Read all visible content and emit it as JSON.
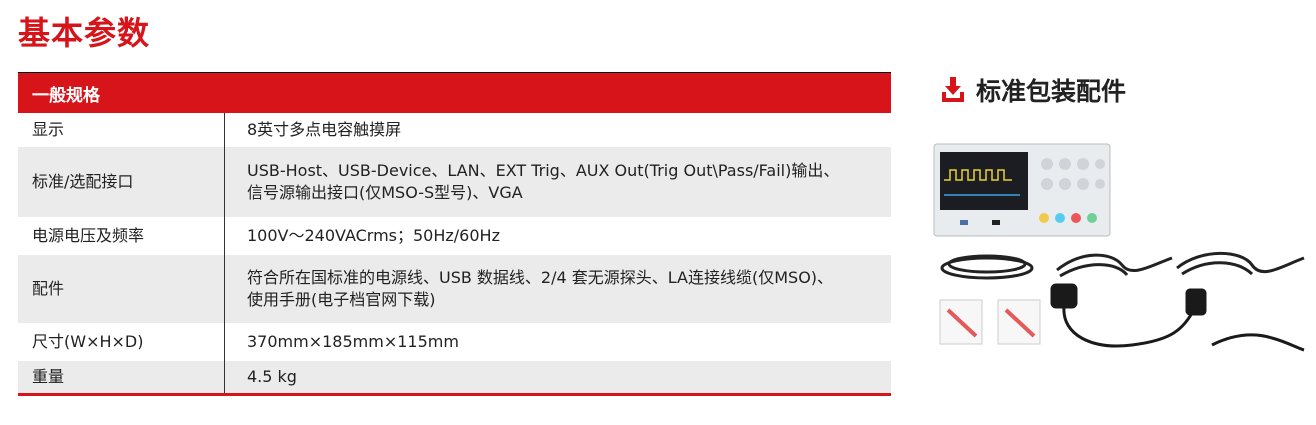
{
  "page_title": "基本参数",
  "spec_table": {
    "header": "一般规格",
    "rows": [
      {
        "label": "显示",
        "value": "8英寸多点电容触摸屏"
      },
      {
        "label": "标准/选配接口",
        "value": "USB-Host、USB-Device、LAN、EXT Trig、AUX Out(Trig Out\\Pass/Fail)输出、\n信号源输出接口(仅MSO-S型号)、VGA"
      },
      {
        "label": "电源电压及频率",
        "value": "100V～240VACrms；50Hz/60Hz"
      },
      {
        "label": "配件",
        "value": "符合所在国标准的电源线、USB 数据线、2/4 套无源探头、LA连接线缆(仅MSO)、\n使用手册(电子档官网下载)"
      },
      {
        "label": "尺寸(W×H×D)",
        "value": "370mm×185mm×115mm"
      },
      {
        "label": "重量",
        "value": "4.5 kg"
      }
    ]
  },
  "accessories": {
    "title": "标准包装配件",
    "icon": "download-icon"
  },
  "colors": {
    "accent": "#d7141a",
    "stripe": "#ebebeb"
  }
}
